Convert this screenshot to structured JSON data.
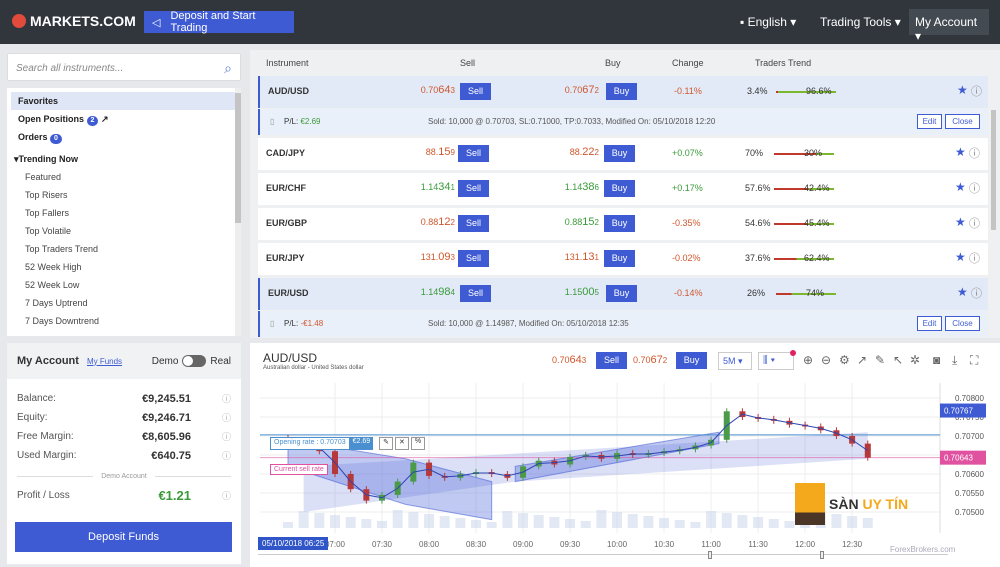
{
  "header": {
    "logo": "MARKETS.COM",
    "deposit_trading": "Deposit and Start Trading",
    "language": "English",
    "trading_tools": "Trading Tools",
    "my_account": "My Account"
  },
  "sidebar": {
    "search_placeholder": "Search all instruments...",
    "items": [
      {
        "label": "Favorites"
      },
      {
        "label": "Open Positions",
        "badge": "2"
      },
      {
        "label": "Orders",
        "badge": "0"
      },
      {
        "label": "Trending Now"
      },
      {
        "label": "Featured"
      },
      {
        "label": "Top Risers"
      },
      {
        "label": "Top Fallers"
      },
      {
        "label": "Top Volatile"
      },
      {
        "label": "Top Traders Trend"
      },
      {
        "label": "52 Week High"
      },
      {
        "label": "52 Week Low"
      },
      {
        "label": "7 Days Uptrend"
      },
      {
        "label": "7 Days Downtrend"
      }
    ]
  },
  "account": {
    "title": "My Account",
    "my_funds": "My Funds",
    "demo": "Demo",
    "real": "Real",
    "mode": "Demo",
    "rows": [
      {
        "label": "Balance:",
        "value": "€9,245.51"
      },
      {
        "label": "Equity:",
        "value": "€9,246.71"
      },
      {
        "label": "Free Margin:",
        "value": "€8,605.96"
      },
      {
        "label": "Used Margin:",
        "value": "€640.75"
      }
    ],
    "divider": "Demo Account",
    "pl_label": "Profit / Loss",
    "pl_value": "€1.21",
    "deposit": "Deposit Funds"
  },
  "table": {
    "headers": {
      "instrument": "Instrument",
      "sell": "Sell",
      "buy": "Buy",
      "change": "Change",
      "trend": "Traders Trend"
    },
    "sell_label": "Sell",
    "buy_label": "Buy",
    "edit": "Edit",
    "close": "Close",
    "rows": [
      {
        "name": "AUD/USD",
        "sell": [
          "0.70",
          "64",
          "3"
        ],
        "buy": [
          "0.70",
          "67",
          "2"
        ],
        "dir": "red",
        "change": "-0.11%",
        "sellp": "3.4%",
        "buyp": "96.6%",
        "sellfrac": 0.034,
        "pos": {
          "pl_label": "P/L:",
          "pl": "€2.69",
          "detail": "Sold: 10,000 @ 0.70703,  SL:0.71000,  TP:0.7033,  Modified On: 05/10/2018 12:20"
        }
      },
      {
        "name": "CAD/JPY",
        "sell": [
          "88.",
          "15",
          "9"
        ],
        "buy": [
          "88.",
          "22",
          "2"
        ],
        "dir": "red",
        "change": "+0.07%",
        "sellp": "70%",
        "buyp": "30%",
        "sellfrac": 0.7
      },
      {
        "name": "EUR/CHF",
        "sell": [
          "1.14",
          "34",
          "1"
        ],
        "buy": [
          "1.14",
          "38",
          "6"
        ],
        "dir": "grn",
        "change": "+0.17%",
        "sellp": "57.6%",
        "buyp": "42.4%",
        "sellfrac": 0.576
      },
      {
        "name": "EUR/GBP",
        "sell": [
          "0.88",
          "12",
          "2"
        ],
        "buy": [
          "0.88",
          "15",
          "2"
        ],
        "dir": "red",
        "buydir": "grn",
        "change": "-0.35%",
        "sellp": "54.6%",
        "buyp": "45.4%",
        "sellfrac": 0.546
      },
      {
        "name": "EUR/JPY",
        "sell": [
          "131.",
          "09",
          "3"
        ],
        "buy": [
          "131.",
          "13",
          "1"
        ],
        "dir": "red",
        "change": "-0.02%",
        "sellp": "37.6%",
        "buyp": "62.4%",
        "sellfrac": 0.376
      },
      {
        "name": "EUR/USD",
        "sell": [
          "1.14",
          "98",
          "4"
        ],
        "buy": [
          "1.15",
          "00",
          "5"
        ],
        "dir": "grn",
        "change": "-0.14%",
        "sellp": "26%",
        "buyp": "74%",
        "sellfrac": 0.26,
        "pos": {
          "pl_label": "P/L:",
          "pl": "-€1.48",
          "detail": "Sold: 10,000 @ 1.14987,  Modified On: 05/10/2018 12:35"
        }
      }
    ]
  },
  "chart": {
    "symbol": "AUD/USD",
    "description": "Australian dollar - United States dollar",
    "sell": [
      "0.70",
      "64",
      "3"
    ],
    "buy": [
      "0.70",
      "67",
      "2"
    ],
    "sell_label": "Sell",
    "buy_label": "Buy",
    "interval": "5M",
    "opening_rate": "Opening rate : 0.70703",
    "opening_pl": "€2.69",
    "current_sell_rate": "Current sell rate",
    "crosshair_time": "05/10/2018 06:25",
    "y_ticks": [
      "0.70800",
      "0.70750",
      "0.70700",
      "0.70650",
      "0.70600",
      "0.70550",
      "0.70500"
    ],
    "y_tick_values": [
      0.708,
      0.7075,
      0.707,
      0.7065,
      0.706,
      0.7055,
      0.705
    ],
    "x_ticks": [
      "07:00",
      "07:30",
      "08:00",
      "08:30",
      "09:00",
      "09:30",
      "10:00",
      "10:30",
      "11:00",
      "11:30",
      "12:00",
      "12:30"
    ],
    "high_label": "0.70767",
    "high_value": 0.70767,
    "current_label": "0.70643",
    "current_value": 0.70643,
    "opening_value": 0.70703,
    "candle_start": "06:30",
    "candle_step_min": 10,
    "closes": [
      0.70685,
      0.7068,
      0.7066,
      0.706,
      0.7056,
      0.7053,
      0.70545,
      0.7058,
      0.7063,
      0.70595,
      0.7059,
      0.706,
      0.70605,
      0.706,
      0.7059,
      0.7062,
      0.70635,
      0.70625,
      0.70645,
      0.7065,
      0.7064,
      0.70655,
      0.7065,
      0.70655,
      0.7066,
      0.70665,
      0.70675,
      0.7069,
      0.70765,
      0.7075,
      0.70745,
      0.7074,
      0.7073,
      0.70725,
      0.70715,
      0.707,
      0.7068,
      0.70643
    ],
    "colors": {
      "up": "#4a9a4a",
      "down": "#b5383a",
      "band": "#4a63d6",
      "current": "#e052a0",
      "axis_label": "#3f5bd3"
    },
    "watermark": "SÀN UY TÍN",
    "watermark_a": "SÀN ",
    "watermark_b": "UY TÍN",
    "brand_watermark": "ForexBrokers.com"
  }
}
